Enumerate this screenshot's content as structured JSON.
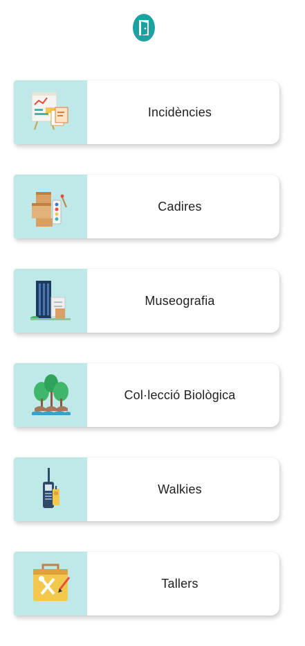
{
  "colors": {
    "accent": "#1aa3a0",
    "thumb_bg": "#bfe8e8"
  },
  "header": {
    "logo_icon": "door-logo-icon"
  },
  "menu": {
    "items": [
      {
        "label": "Incidències",
        "icon": "presentation-board-icon"
      },
      {
        "label": "Cadires",
        "icon": "boxes-paint-icon"
      },
      {
        "label": "Museografia",
        "icon": "building-exhibit-icon"
      },
      {
        "label": "Col·lecció Biològica",
        "icon": "trees-icon"
      },
      {
        "label": "Walkies",
        "icon": "walkie-talkie-icon"
      },
      {
        "label": "Tallers",
        "icon": "toolbox-icon"
      }
    ]
  }
}
